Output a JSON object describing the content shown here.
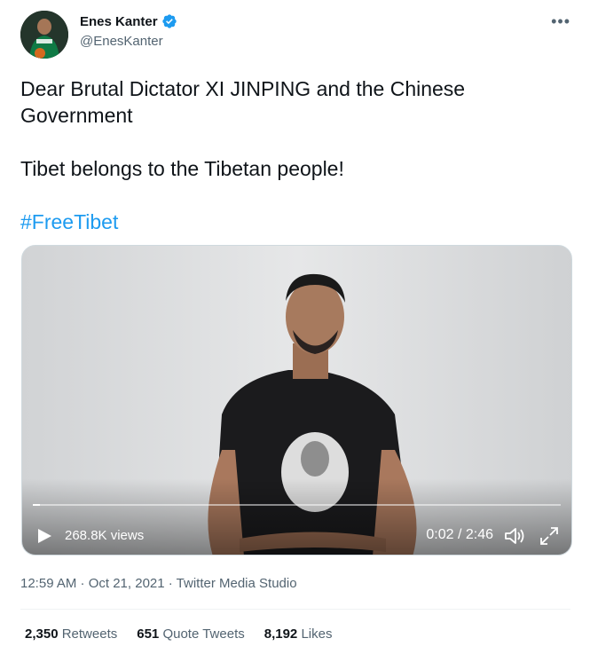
{
  "user": {
    "name": "Enes Kanter",
    "handle": "@EnesKanter",
    "verified": true
  },
  "tweet": {
    "lines": [
      "Dear Brutal Dictator XI JINPING and the Chinese Government",
      "Tibet belongs to the Tibetan people!",
      "#FreeTibet"
    ]
  },
  "video": {
    "views": "268.8K views",
    "time": "0:02 / 2:46",
    "progress": 0.013
  },
  "meta": {
    "timestamp": "12:59 AM · Oct 21, 2021 · Twitter Media Studio"
  },
  "stats": [
    {
      "count": "2,350",
      "label": "Retweets"
    },
    {
      "count": "651",
      "label": "Quote Tweets"
    },
    {
      "count": "8,192",
      "label": "Likes"
    }
  ],
  "colors": {
    "accent": "#1d9bf0",
    "secondary_text": "#536471"
  },
  "icons": [
    "verified-badge-icon",
    "more-icon",
    "play-icon",
    "volume-icon",
    "fullscreen-icon"
  ]
}
